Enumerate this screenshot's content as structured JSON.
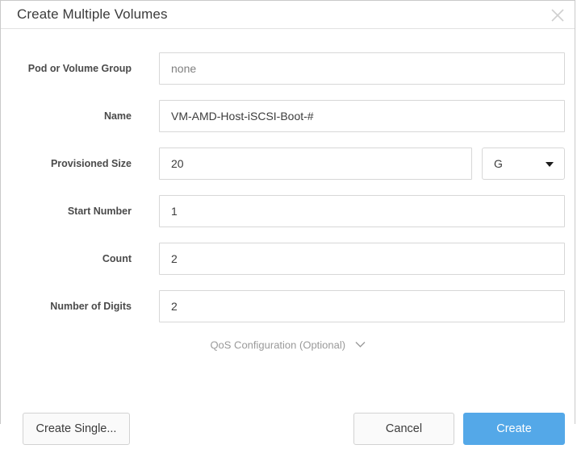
{
  "dialog": {
    "title": "Create Multiple Volumes",
    "close_icon": "close-icon"
  },
  "form": {
    "fields": [
      {
        "label": "Pod or Volume Group",
        "value": "none",
        "name": "pod-or-volume-group"
      },
      {
        "label": "Name",
        "value": "VM-AMD-Host-iSCSI-Boot-#",
        "name": "name"
      },
      {
        "label": "Provisioned Size",
        "value": "20",
        "name": "provisioned-size"
      },
      {
        "label": "Start Number",
        "value": "1",
        "name": "start-number"
      },
      {
        "label": "Count",
        "value": "2",
        "name": "count"
      },
      {
        "label": "Number of Digits",
        "value": "2",
        "name": "number-of-digits"
      }
    ],
    "size_unit": {
      "selected": "G",
      "caret_icon": "chevron-down-icon"
    },
    "qos": {
      "label": "QoS Configuration (Optional)",
      "caret_icon": "chevron-down-icon"
    }
  },
  "footer": {
    "create_single_label": "Create Single...",
    "cancel_label": "Cancel",
    "create_label": "Create"
  },
  "colors": {
    "primary": "#54a8e8",
    "field_border": "#d7d7d7",
    "label_text": "#4a4a4a",
    "muted_text": "#9a9a9a"
  }
}
